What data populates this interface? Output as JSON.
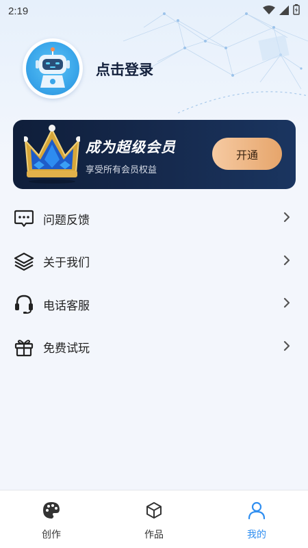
{
  "status_bar": {
    "time": "2:19"
  },
  "profile": {
    "login_label": "点击登录",
    "avatar_icon": "robot-avatar-icon"
  },
  "vip": {
    "title": "成为超级会员",
    "subtitle": "享受所有会员权益",
    "button_label": "开通"
  },
  "menu": {
    "items": [
      {
        "label": "问题反馈",
        "icon": "message-dots-icon"
      },
      {
        "label": "关于我们",
        "icon": "layers-icon"
      },
      {
        "label": "电话客服",
        "icon": "headset-icon"
      },
      {
        "label": "免费试玩",
        "icon": "gift-icon"
      }
    ]
  },
  "tabbar": {
    "active": "我的",
    "tabs": [
      {
        "label": "创作",
        "icon": "palette-icon"
      },
      {
        "label": "作品",
        "icon": "cube-icon"
      },
      {
        "label": "我的",
        "icon": "user-icon"
      }
    ]
  },
  "colors": {
    "accent": "#2f8ef0",
    "vip_bg": "#14264a",
    "vip_button": "#eab585"
  }
}
